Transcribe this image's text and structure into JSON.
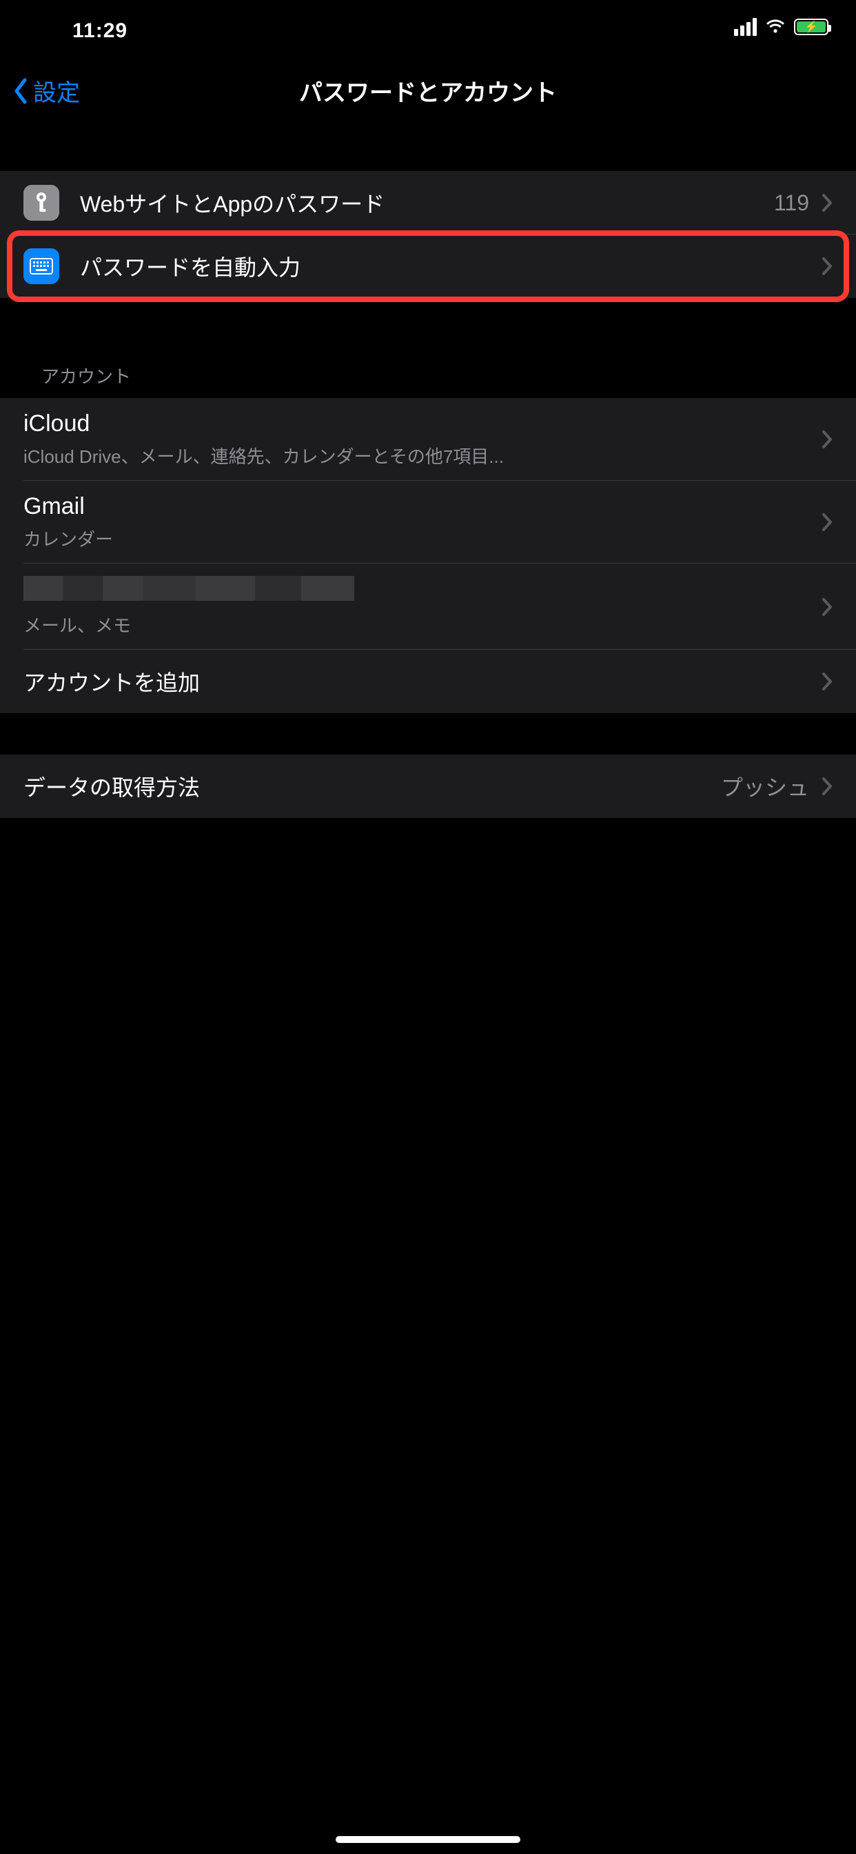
{
  "statusbar": {
    "time": "11:29"
  },
  "nav": {
    "back": "設定",
    "title": "パスワードとアカウント"
  },
  "passwords_group": {
    "websites": {
      "label": "WebサイトとAppのパスワード",
      "count": "119"
    },
    "autofill": {
      "label": "パスワードを自動入力"
    }
  },
  "accounts_header": "アカウント",
  "accounts": {
    "icloud": {
      "name": "iCloud",
      "detail": "iCloud Drive、メール、連絡先、カレンダーとその他7項目..."
    },
    "gmail": {
      "name": "Gmail",
      "detail": "カレンダー"
    },
    "redacted": {
      "detail": "メール、メモ"
    },
    "add": {
      "label": "アカウントを追加"
    }
  },
  "fetch": {
    "label": "データの取得方法",
    "value": "プッシュ"
  }
}
